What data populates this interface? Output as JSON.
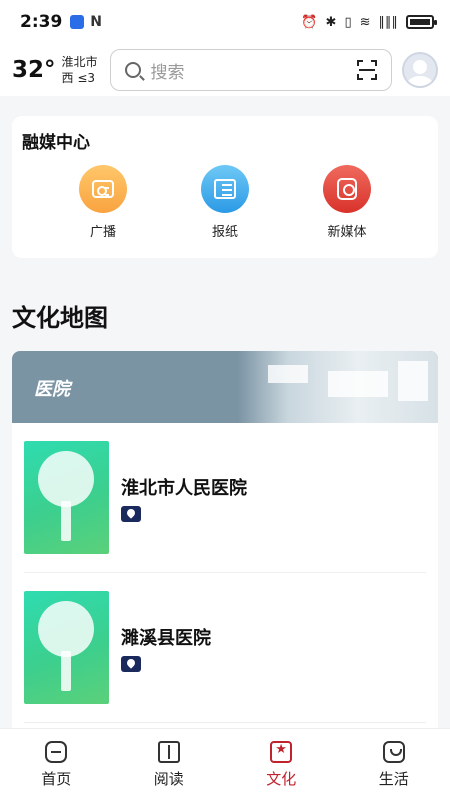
{
  "status_bar": {
    "time": "2:39",
    "nfc": "N",
    "signal": "∥∥∥"
  },
  "header": {
    "temperature": "32°",
    "city": "淮北市",
    "wind": "西 ≤3",
    "search_placeholder": "搜索"
  },
  "media_center": {
    "title": "融媒中心",
    "items": [
      {
        "label": "广播",
        "icon": "radio-icon",
        "color": "#f9a340"
      },
      {
        "label": "报纸",
        "icon": "newspaper-icon",
        "color": "#2c9ae6"
      },
      {
        "label": "新媒体",
        "icon": "new-media-icon",
        "color": "#d8322a"
      }
    ]
  },
  "culture_map": {
    "title": "文化地图",
    "category": "医院",
    "items": [
      {
        "name": "淮北市人民医院",
        "badge": "location-pin-icon"
      },
      {
        "name": "濉溪县医院",
        "badge": "location-pin-icon"
      }
    ]
  },
  "bottom_nav": {
    "items": [
      {
        "label": "首页",
        "icon": "home-icon"
      },
      {
        "label": "阅读",
        "icon": "book-icon"
      },
      {
        "label": "文化",
        "icon": "culture-icon",
        "active": true
      },
      {
        "label": "生活",
        "icon": "life-icon"
      }
    ],
    "active_color": "#c0222e"
  }
}
